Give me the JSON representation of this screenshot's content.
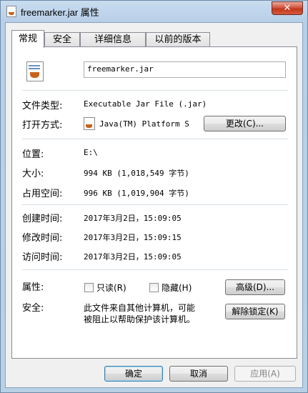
{
  "window": {
    "title": "freemarker.jar 属性",
    "close_label": "✕"
  },
  "tabs": [
    "常规",
    "安全",
    "详细信息",
    "以前的版本"
  ],
  "general": {
    "filename": "freemarker.jar",
    "file_type_label": "文件类型:",
    "file_type_value": "Executable Jar File (.jar)",
    "opens_with_label": "打开方式:",
    "opens_with_value": "Java(TM) Platform S",
    "change_button": "更改(C)...",
    "location_label": "位置:",
    "location_value": "E:\\",
    "size_label": "大小:",
    "size_value": "994 KB (1,018,549 字节)",
    "size_on_disk_label": "占用空间:",
    "size_on_disk_value": "996 KB (1,019,904 字节)",
    "created_label": "创建时间:",
    "created_value": "2017年3月2日，15:09:05",
    "modified_label": "修改时间:",
    "modified_value": "2017年3月2日，15:09:15",
    "accessed_label": "访问时间:",
    "accessed_value": "2017年3月2日，15:09:05",
    "attributes_label": "属性:",
    "readonly_label": "只读(R)",
    "hidden_label": "隐藏(H)",
    "advanced_button": "高级(D)...",
    "security_label": "安全:",
    "security_text_1": "此文件来自其他计算机，可能",
    "security_text_2": "被阻止以帮助保护该计算机。",
    "unblock_button": "解除锁定(K)"
  },
  "footer": {
    "ok": "确定",
    "cancel": "取消",
    "apply": "应用(A)"
  }
}
